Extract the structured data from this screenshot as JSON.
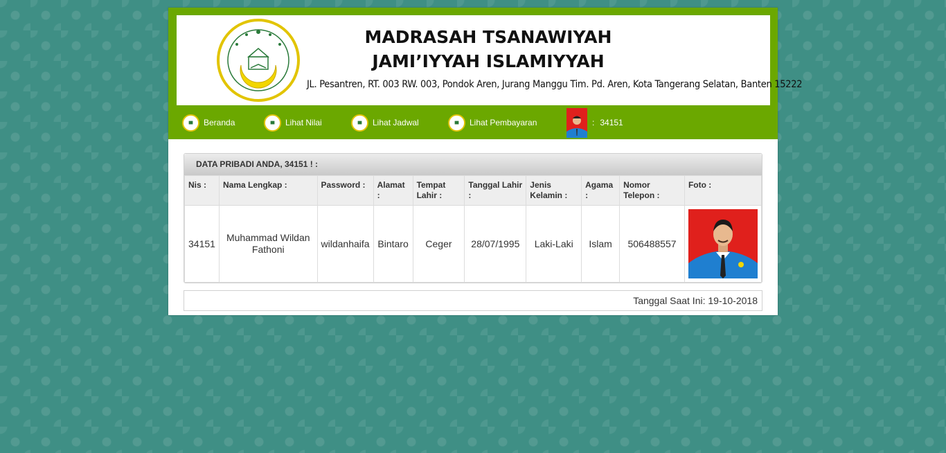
{
  "header": {
    "school_name_line1": "MADRASAH TSANAWIYAH",
    "school_name_line2": "JAMI’IYYAH ISLAMIYYAH",
    "address": "JL. Pesantren, RT. 003 RW. 003, Pondok Aren, Jurang Manggu Tim. Pd. Aren, Kota Tangerang Selatan, Banten 15222",
    "seal_text": "MTs. JAM'IYYAH ISLAMIYYAH"
  },
  "nav": {
    "items": [
      {
        "label": "Beranda",
        "icon": "school-seal-icon"
      },
      {
        "label": "Lihat Nilai",
        "icon": "school-seal-icon"
      },
      {
        "label": "Lihat Jadwal",
        "icon": "school-seal-icon"
      },
      {
        "label": "Lihat Pembayaran",
        "icon": "school-seal-icon"
      }
    ],
    "user_separator": ":",
    "user_id": "34151"
  },
  "panel": {
    "title": "DATA PRIBADI ANDA, 34151 ! :",
    "columns": [
      "Nis :",
      "Nama Lengkap :",
      "Password :",
      "Alamat :",
      "Tempat Lahir :",
      "Tanggal Lahir :",
      "Jenis Kelamin :",
      "Agama :",
      "Nomor Telepon :",
      "Foto :"
    ],
    "row": {
      "nis": "34151",
      "nama": "Muhammad Wildan Fathoni",
      "password": "wildanhaifa",
      "alamat": "Bintaro",
      "tempat_lahir": "Ceger",
      "tanggal_lahir": "28/07/1995",
      "jenis_kelamin": "Laki-Laki",
      "agama": "Islam",
      "telepon": "506488557"
    }
  },
  "footer": {
    "date_text": "Tanggal Saat Ini: 19-10-2018"
  },
  "colors": {
    "header_green": "#6ba800",
    "page_background": "#3f8f85",
    "seal_yellow": "#f2d600",
    "photo_red": "#e0201c",
    "photo_blue": "#1f7fd0"
  }
}
